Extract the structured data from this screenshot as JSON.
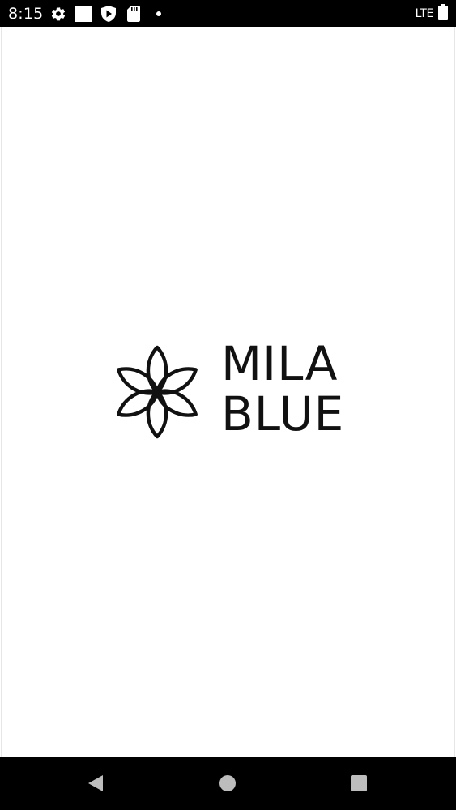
{
  "status_bar": {
    "time": "8:15",
    "network": "LTE",
    "icons": [
      "gear-icon",
      "square-notification-icon",
      "shield-play-icon",
      "sd-card-icon",
      "dot-icon",
      "battery-icon"
    ]
  },
  "splash": {
    "brand_line_1": "MILA",
    "brand_line_2": "BLUE",
    "logo_icon": "flower-logo-icon"
  },
  "nav_bar": {
    "icons": [
      "back-triangle-icon",
      "home-circle-icon",
      "recents-square-icon"
    ]
  },
  "colors": {
    "bar_background": "#000000",
    "screen_background": "#ffffff",
    "brand_text": "#111111",
    "nav_icon": "#bdbdbd"
  }
}
